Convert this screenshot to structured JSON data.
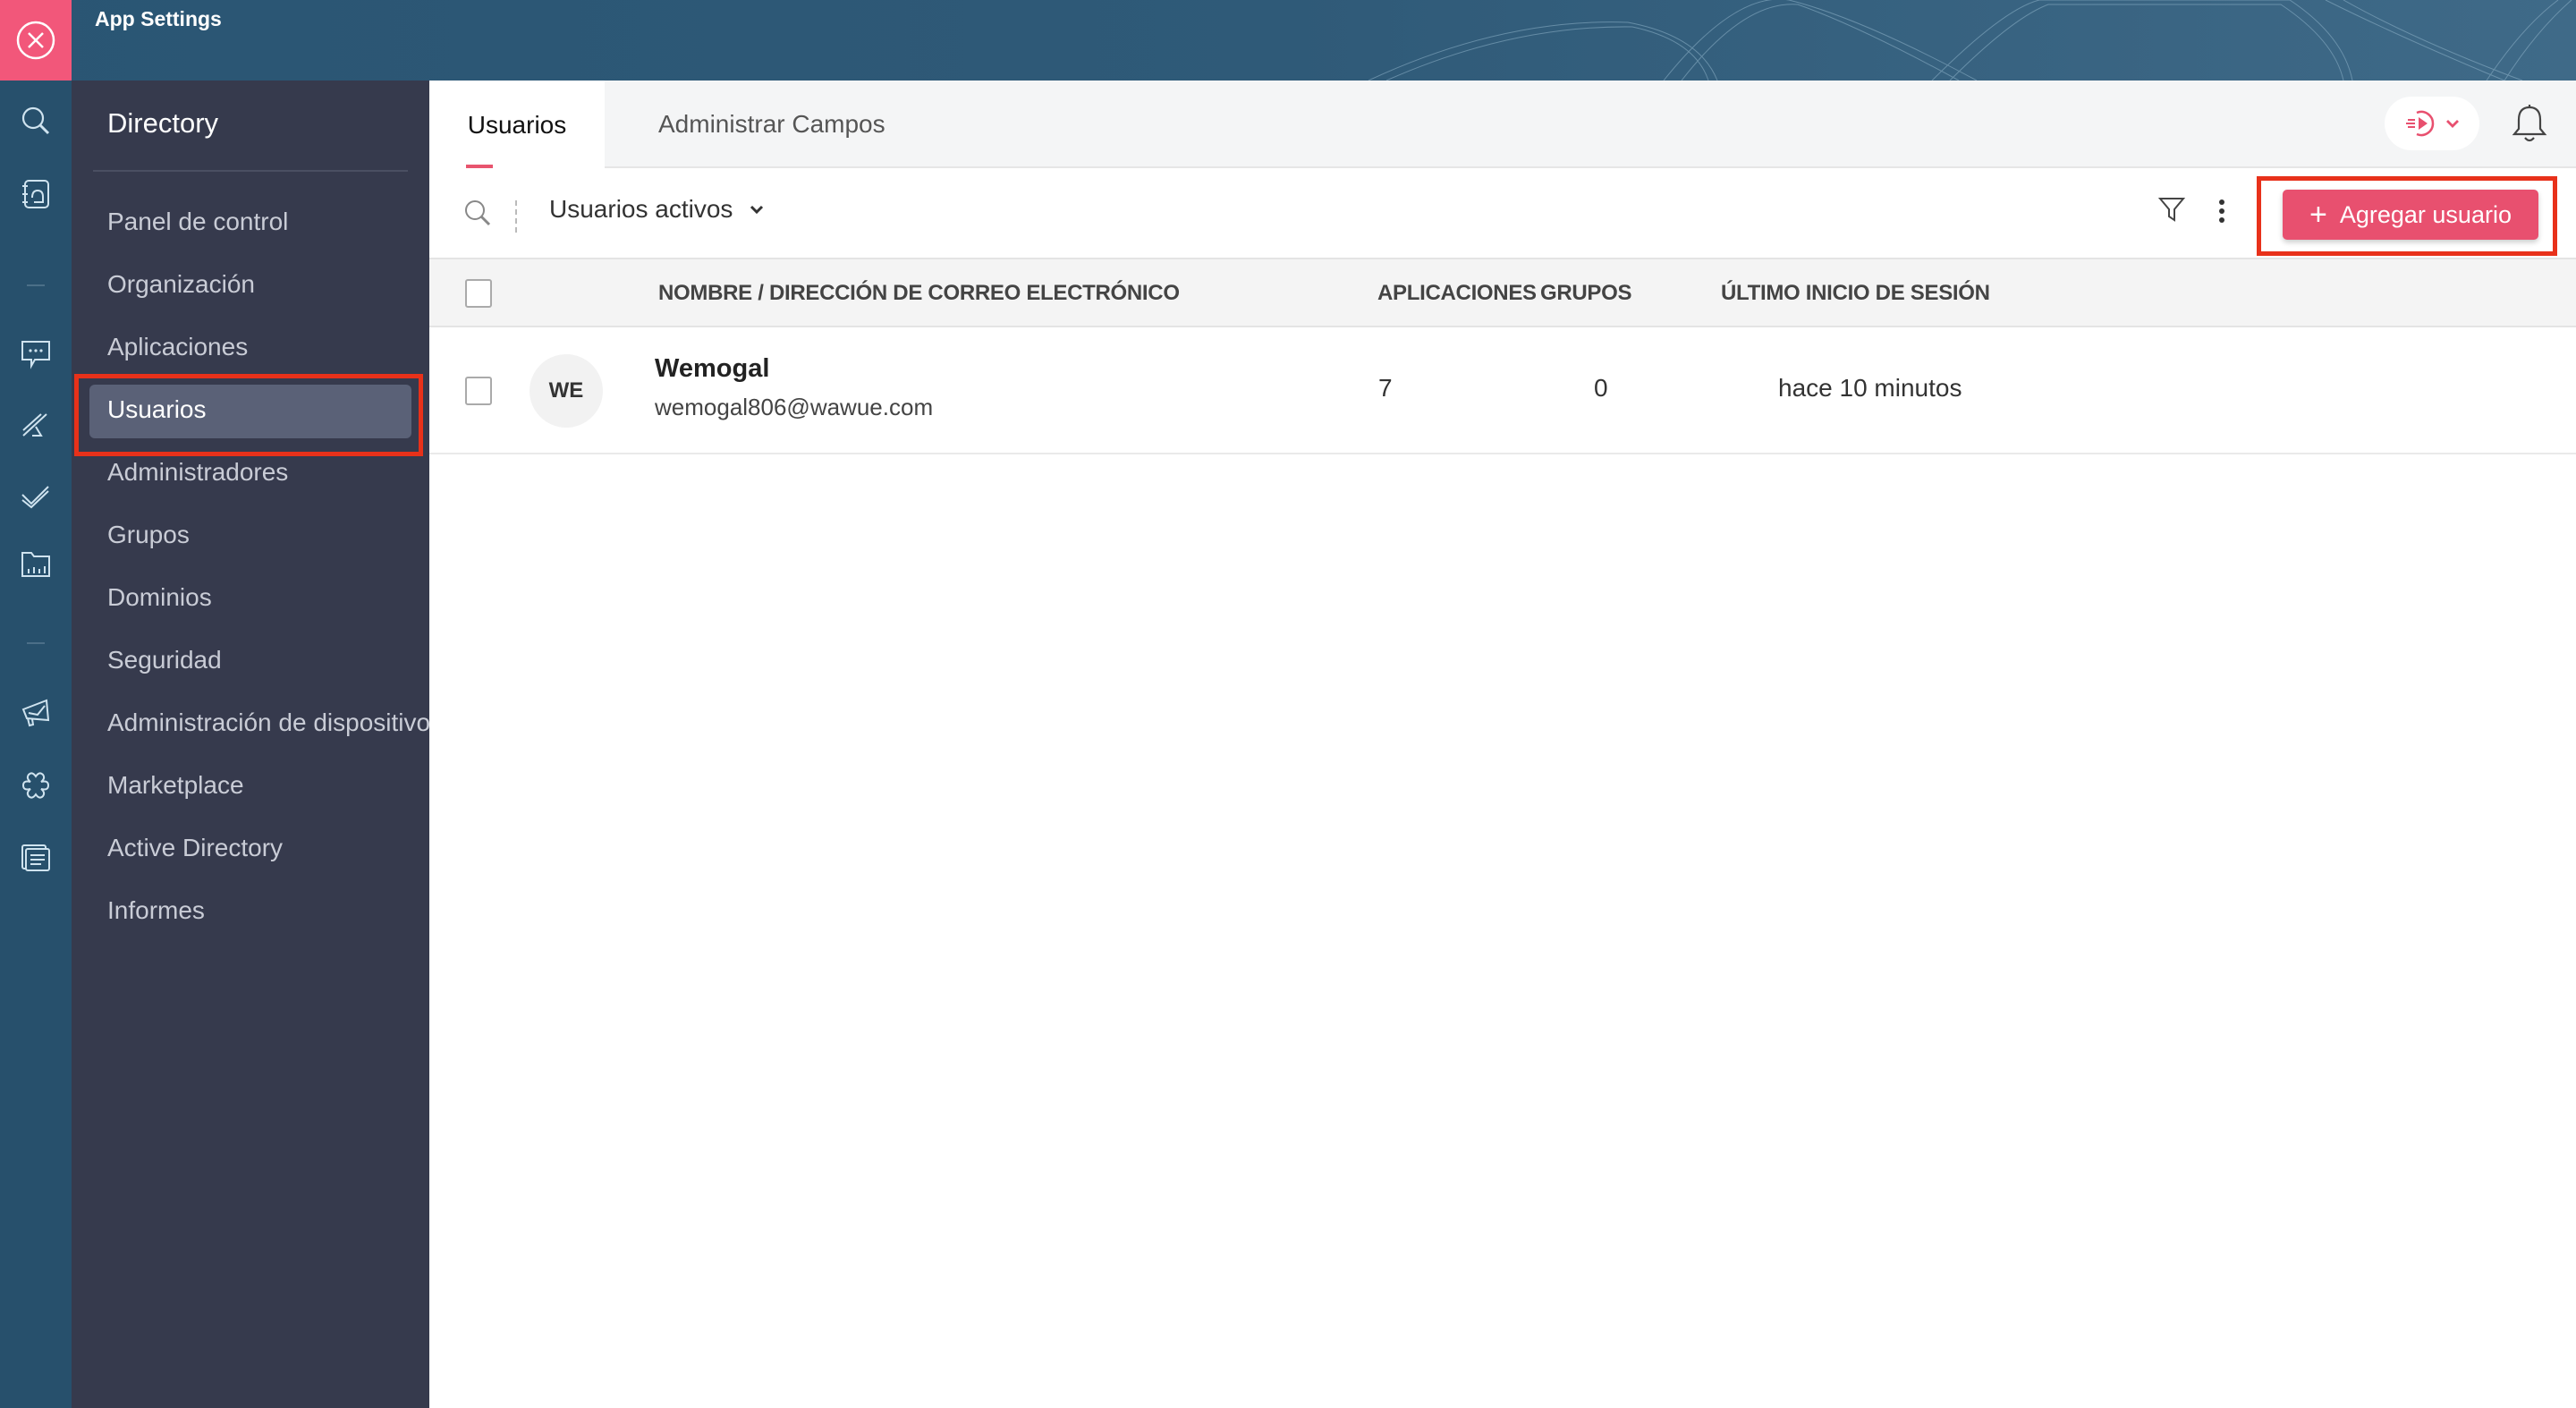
{
  "app": {
    "title": "App Settings",
    "close_icon": "close-circle-icon"
  },
  "rail": {
    "icons": [
      "search-icon",
      "contacts-icon",
      "chat-icon",
      "projects-icon",
      "tasks-icon",
      "files-icon",
      "campaigns-icon",
      "integrations-icon",
      "documents-icon"
    ]
  },
  "sidebar": {
    "title": "Directory",
    "items": [
      {
        "label": "Panel de control"
      },
      {
        "label": "Organización"
      },
      {
        "label": "Aplicaciones"
      },
      {
        "label": "Usuarios",
        "active": true
      },
      {
        "label": "Administradores"
      },
      {
        "label": "Grupos"
      },
      {
        "label": "Dominios"
      },
      {
        "label": "Seguridad"
      },
      {
        "label": "Administración de dispositivos"
      },
      {
        "label": "Marketplace"
      },
      {
        "label": "Active Directory"
      },
      {
        "label": "Informes"
      }
    ]
  },
  "tabs": [
    {
      "label": "Usuarios",
      "active": true
    },
    {
      "label": "Administrar Campos",
      "active": false
    }
  ],
  "toolbar": {
    "filter_select": "Usuarios activos",
    "add_button": "Agregar usuario",
    "add_button_icon": "+"
  },
  "table": {
    "headers": {
      "name": "NOMBRE / DIRECCIÓN DE CORREO ELECTRÓNICO",
      "apps": "APLICACIONES",
      "groups": "GRUPOS",
      "last_login": "ÚLTIMO INICIO DE SESIÓN"
    },
    "rows": [
      {
        "initials": "WE",
        "name": "Wemogal",
        "email": "wemogal806@wawue.com",
        "apps": "7",
        "groups": "0",
        "last_login": "hace 10 minutos"
      }
    ]
  },
  "colors": {
    "accent": "#e8506f",
    "header": "#2a5573",
    "sidebar": "#363a4d",
    "highlight": "#e8311a"
  }
}
